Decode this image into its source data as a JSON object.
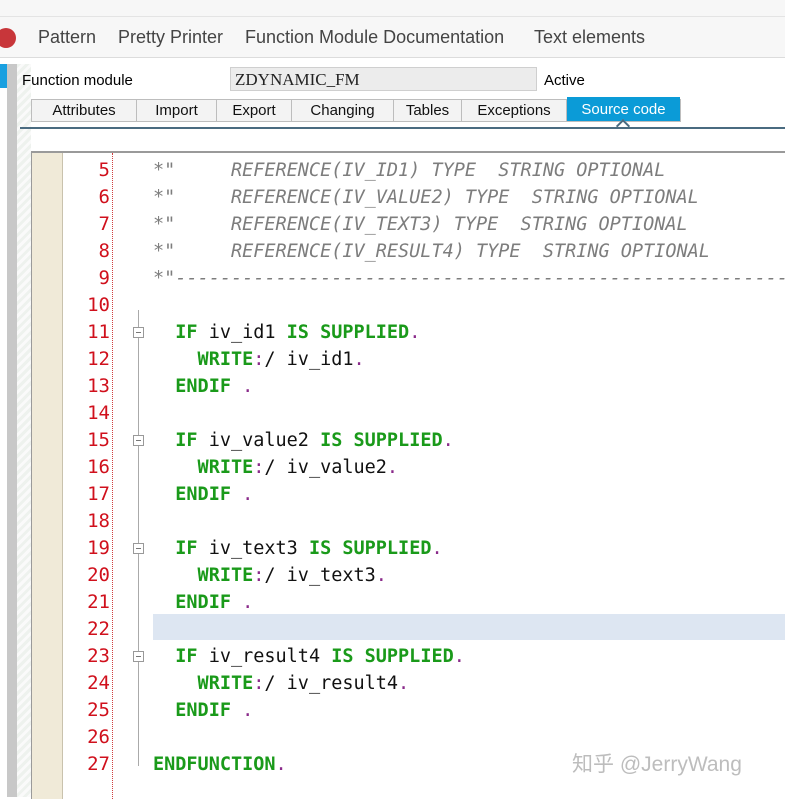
{
  "toolbar": {
    "items": [
      "Pattern",
      "Pretty Printer",
      "Function Module Documentation",
      "Text elements"
    ]
  },
  "form": {
    "label": "Function module",
    "value": "ZDYNAMIC_FM",
    "status": "Active"
  },
  "tabs": [
    {
      "label": "Attributes",
      "w": 104
    },
    {
      "label": "Import",
      "w": 79
    },
    {
      "label": "Export",
      "w": 74
    },
    {
      "label": "Changing",
      "w": 101
    },
    {
      "label": "Tables",
      "w": 67
    },
    {
      "label": "Exceptions",
      "w": 104
    },
    {
      "label": "Source code",
      "w": 113,
      "active": true
    }
  ],
  "editor": {
    "highlighted_line": 22,
    "lines": [
      {
        "n": "5",
        "tokens": [
          {
            "t": "*\"     REFERENCE(IV_ID1) TYPE  STRING OPTIONAL",
            "c": "cm"
          }
        ]
      },
      {
        "n": "6",
        "tokens": [
          {
            "t": "*\"     REFERENCE(IV_VALUE2) TYPE  STRING OPTIONAL",
            "c": "cm"
          }
        ]
      },
      {
        "n": "7",
        "tokens": [
          {
            "t": "*\"     REFERENCE(IV_TEXT3) TYPE  STRING OPTIONAL",
            "c": "cm"
          }
        ]
      },
      {
        "n": "8",
        "tokens": [
          {
            "t": "*\"     REFERENCE(IV_RESULT4) TYPE  STRING OPTIONAL",
            "c": "cm"
          }
        ]
      },
      {
        "n": "9",
        "tokens": [
          {
            "t": "*\"----------------------------------------------------------",
            "c": "cm"
          }
        ]
      },
      {
        "n": "10",
        "tokens": []
      },
      {
        "n": "11",
        "fold": true,
        "tokens": [
          {
            "t": "  IF",
            "c": "kw"
          },
          {
            "t": " iv_id1 ",
            "c": "id"
          },
          {
            "t": "IS SUPPLIED",
            "c": "kw"
          },
          {
            "t": ".",
            "c": "p"
          }
        ]
      },
      {
        "n": "12",
        "tokens": [
          {
            "t": "    WRITE",
            "c": "kw"
          },
          {
            "t": ":",
            "c": "p"
          },
          {
            "t": "/ iv_id1",
            "c": "id"
          },
          {
            "t": ".",
            "c": "p"
          }
        ]
      },
      {
        "n": "13",
        "tokens": [
          {
            "t": "  ENDIF",
            "c": "kw"
          },
          {
            "t": " .",
            "c": "p"
          }
        ]
      },
      {
        "n": "14",
        "tokens": []
      },
      {
        "n": "15",
        "fold": true,
        "tokens": [
          {
            "t": "  IF",
            "c": "kw"
          },
          {
            "t": " iv_value2 ",
            "c": "id"
          },
          {
            "t": "IS SUPPLIED",
            "c": "kw"
          },
          {
            "t": ".",
            "c": "p"
          }
        ]
      },
      {
        "n": "16",
        "tokens": [
          {
            "t": "    WRITE",
            "c": "kw"
          },
          {
            "t": ":",
            "c": "p"
          },
          {
            "t": "/ iv_value2",
            "c": "id"
          },
          {
            "t": ".",
            "c": "p"
          }
        ]
      },
      {
        "n": "17",
        "tokens": [
          {
            "t": "  ENDIF",
            "c": "kw"
          },
          {
            "t": " .",
            "c": "p"
          }
        ]
      },
      {
        "n": "18",
        "tokens": []
      },
      {
        "n": "19",
        "fold": true,
        "tokens": [
          {
            "t": "  IF",
            "c": "kw"
          },
          {
            "t": " iv_text3 ",
            "c": "id"
          },
          {
            "t": "IS SUPPLIED",
            "c": "kw"
          },
          {
            "t": ".",
            "c": "p"
          }
        ]
      },
      {
        "n": "20",
        "tokens": [
          {
            "t": "    WRITE",
            "c": "kw"
          },
          {
            "t": ":",
            "c": "p"
          },
          {
            "t": "/ iv_text3",
            "c": "id"
          },
          {
            "t": ".",
            "c": "p"
          }
        ]
      },
      {
        "n": "21",
        "tokens": [
          {
            "t": "  ENDIF",
            "c": "kw"
          },
          {
            "t": " .",
            "c": "p"
          }
        ]
      },
      {
        "n": "22",
        "tokens": []
      },
      {
        "n": "23",
        "fold": true,
        "tokens": [
          {
            "t": "  IF",
            "c": "kw"
          },
          {
            "t": " iv_result4 ",
            "c": "id"
          },
          {
            "t": "IS SUPPLIED",
            "c": "kw"
          },
          {
            "t": ".",
            "c": "p"
          }
        ]
      },
      {
        "n": "24",
        "tokens": [
          {
            "t": "    WRITE",
            "c": "kw"
          },
          {
            "t": ":",
            "c": "p"
          },
          {
            "t": "/ iv_result4",
            "c": "id"
          },
          {
            "t": ".",
            "c": "p"
          }
        ]
      },
      {
        "n": "25",
        "tokens": [
          {
            "t": "  ENDIF",
            "c": "kw"
          },
          {
            "t": " .",
            "c": "p"
          }
        ]
      },
      {
        "n": "26",
        "tokens": []
      },
      {
        "n": "27",
        "tokens": [
          {
            "t": "ENDFUNCTION",
            "c": "kw"
          },
          {
            "t": ".",
            "c": "p"
          }
        ]
      }
    ]
  },
  "watermark": "知乎 @JerryWang"
}
